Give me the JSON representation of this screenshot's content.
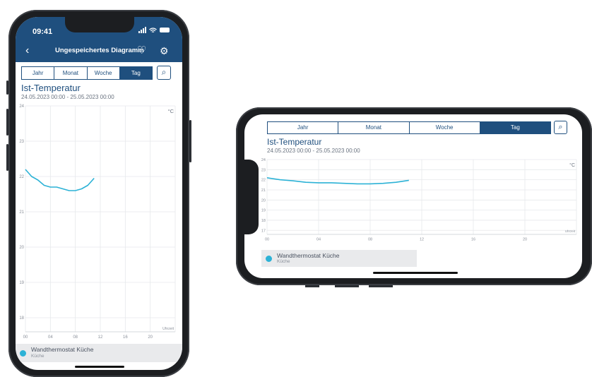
{
  "status": {
    "time": "09:41"
  },
  "nav": {
    "back": "‹",
    "title": "Ungespeichertes Diagramm",
    "favorite_icon": "heart-icon",
    "settings_icon": "gear-icon"
  },
  "periods": [
    "Jahr",
    "Monat",
    "Woche",
    "Tag"
  ],
  "active_period": "Tag",
  "search_icon": "search-icon",
  "panel": {
    "title": "Ist-Temperatur",
    "date_range": "24.05.2023 00:00 - 25.05.2023 00:00"
  },
  "legend": {
    "device": "Wandthermostat Küche",
    "room": "Küche",
    "color": "#2cb2d6"
  },
  "chart_data": {
    "type": "line",
    "title": "Ist-Temperatur",
    "unit_label": "°C",
    "x_unit_label": "Uhrzeit",
    "xlim": [
      0,
      24
    ],
    "ylim": [
      17.6,
      24
    ],
    "x_ticks": [
      "00",
      "04",
      "08",
      "12",
      "16",
      "20"
    ],
    "x_tick_values": [
      0,
      4,
      8,
      12,
      16,
      20
    ],
    "y_ticks_portrait": [
      18,
      19,
      20,
      21,
      22,
      23,
      24
    ],
    "y_ticks_landscape": [
      17,
      18,
      19,
      20,
      21,
      22,
      23,
      24
    ],
    "grid": true,
    "series": [
      {
        "color": "#2cb2d6",
        "x": [
          0,
          1,
          2,
          3,
          4,
          5,
          6,
          7,
          8,
          9,
          10,
          11
        ],
        "y": [
          22.2,
          22.0,
          21.9,
          21.75,
          21.7,
          21.7,
          21.65,
          21.6,
          21.6,
          21.65,
          21.75,
          21.95
        ]
      }
    ]
  }
}
